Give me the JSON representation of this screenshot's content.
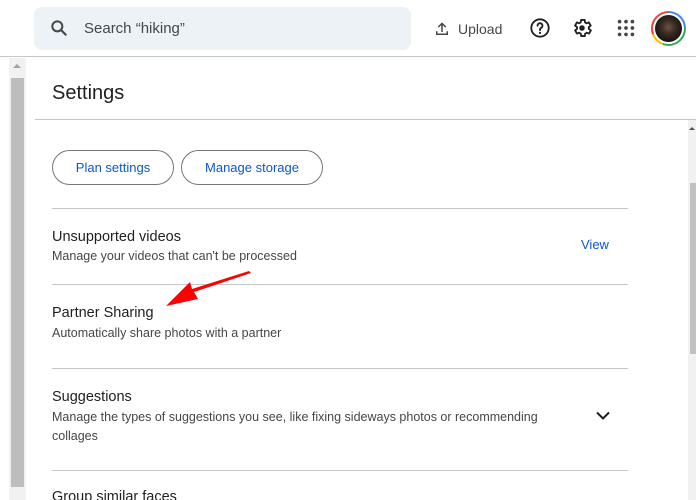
{
  "header": {
    "search_placeholder": "Search “hiking”",
    "upload_label": "Upload",
    "icons": [
      "search-icon",
      "upload-icon",
      "help-icon",
      "settings-gear-icon",
      "apps-grid-icon",
      "account-avatar"
    ]
  },
  "settings": {
    "title": "Settings",
    "buttons": {
      "plan_settings": "Plan settings",
      "manage_storage": "Manage storage"
    },
    "items": [
      {
        "title": "Unsupported videos",
        "description": "Manage your videos that can't be processed",
        "action": "View"
      },
      {
        "title": "Partner Sharing",
        "description": "Automatically share photos with a partner"
      },
      {
        "title": "Suggestions",
        "description": "Manage the types of suggestions you see, like fixing sideways photos or recommending collages",
        "control": "chevron-down-icon"
      },
      {
        "title": "Group similar faces"
      }
    ]
  },
  "annotation": {
    "type": "red-arrow",
    "points_to": "Partner Sharing",
    "color": "#ff0000"
  },
  "colors": {
    "accent": "#0b57d0",
    "search_bg": "#edf2f7",
    "divider": "#c4c7c5",
    "text_primary": "#1f1f1f",
    "text_secondary": "#444746"
  }
}
